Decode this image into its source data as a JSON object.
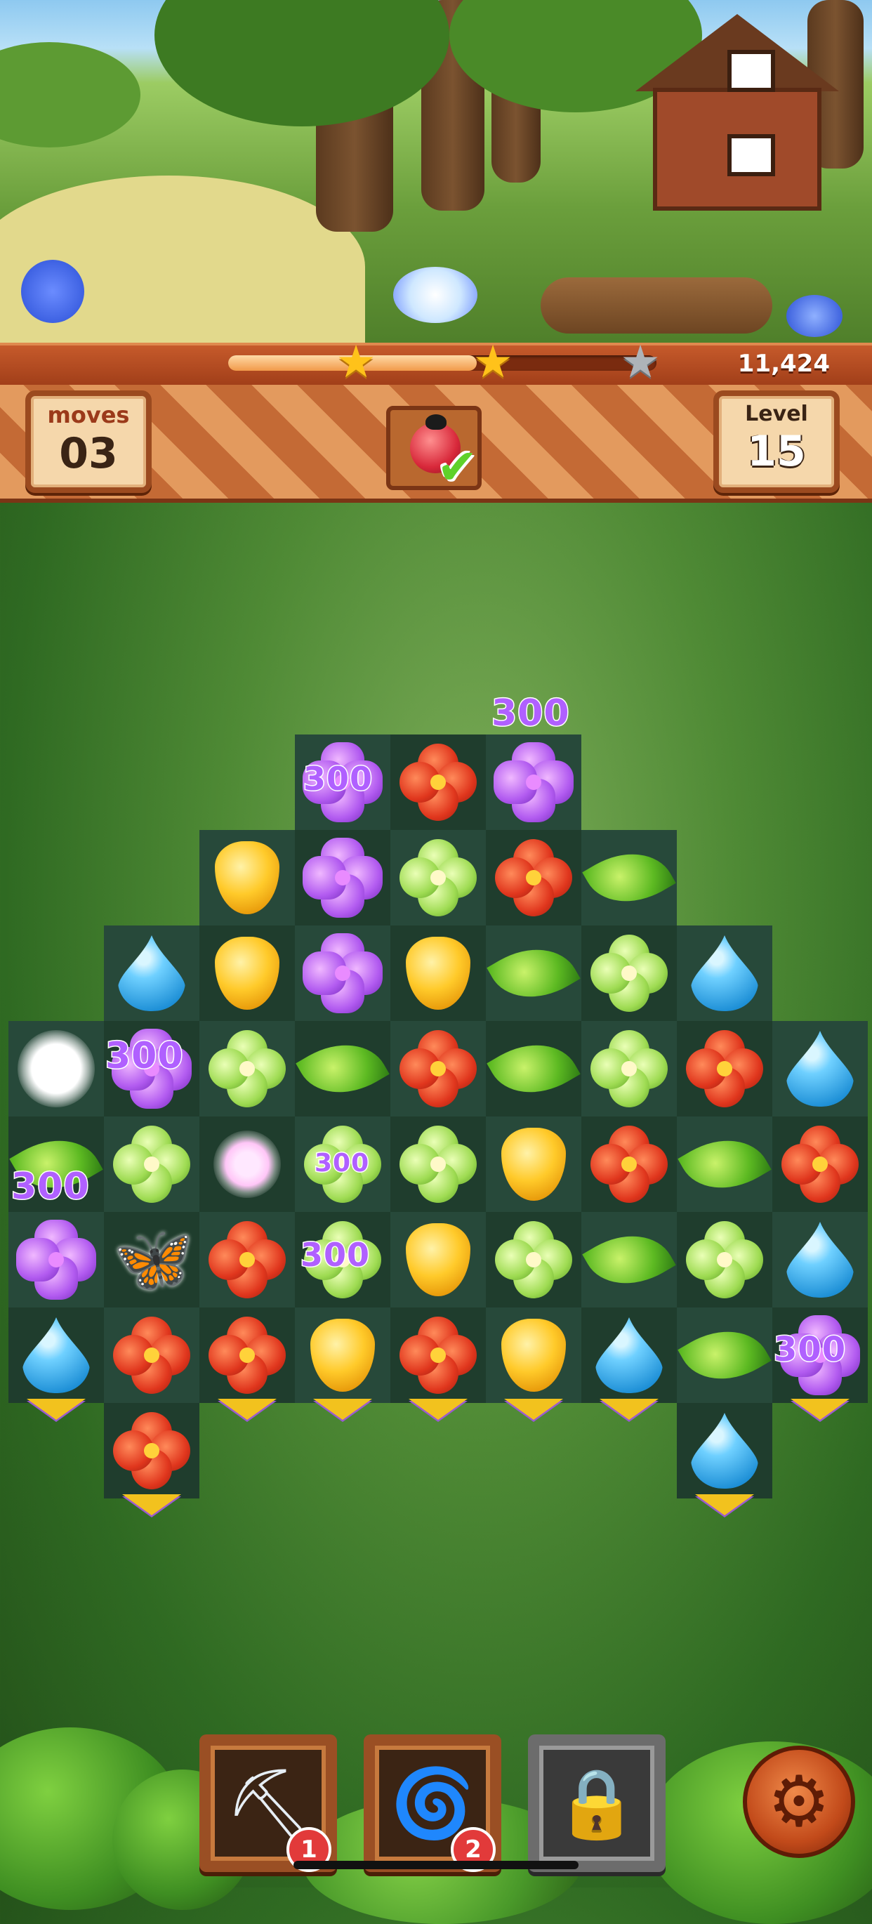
{
  "hud": {
    "moves_label": "moves",
    "moves_value": "03",
    "level_label": "Level",
    "level_value": "15",
    "score": "11,424",
    "progress_fraction": 0.58,
    "stars": [
      "gold",
      "gold",
      "grey"
    ],
    "goal_icon": "ladybug-icon",
    "goal_status": "check-icon"
  },
  "board": {
    "rows": [
      [
        null,
        null,
        null,
        "purple",
        "red",
        "purple",
        null,
        null,
        null
      ],
      [
        null,
        null,
        "tulip",
        "purple",
        "clover",
        "red",
        "leaf",
        null,
        null
      ],
      [
        null,
        "water",
        "tulip",
        "purple",
        "tulip",
        "leaf",
        "clover",
        "water",
        null
      ],
      [
        "glow",
        "purple",
        "clover",
        "leaf",
        "red",
        "leaf",
        "clover",
        "red",
        "water"
      ],
      [
        "leaf",
        "clover",
        "pinkglow",
        "clover",
        "clover",
        "tulip",
        "red",
        "leaf",
        "red"
      ],
      [
        "purple",
        "butterfly",
        "red",
        "clover",
        "tulip",
        "clover",
        "leaf",
        "clover",
        "water"
      ],
      [
        "water",
        "red",
        "red",
        "tulip",
        "red",
        "tulip",
        "water",
        "leaf",
        "purple"
      ],
      [
        null,
        "red",
        null,
        null,
        null,
        null,
        null,
        "water",
        null
      ]
    ],
    "score_popups": [
      "300",
      "300",
      "300",
      "300",
      "300",
      "300",
      "300"
    ]
  },
  "boosters": [
    {
      "name": "trowel",
      "icon": "trowel-icon",
      "count": "1",
      "locked": false
    },
    {
      "name": "rainbow-swirl",
      "icon": "swirl-icon",
      "count": "2",
      "locked": false
    },
    {
      "name": "locked-booster",
      "icon": "lock-icon",
      "count": "",
      "locked": true
    }
  ],
  "colors": {
    "wood": "#9b4a1f",
    "board_cell": "#1f3d2d",
    "score_popup": "#b060ff",
    "star_gold": "#ffc21a",
    "arrow": "#f2c21e"
  }
}
